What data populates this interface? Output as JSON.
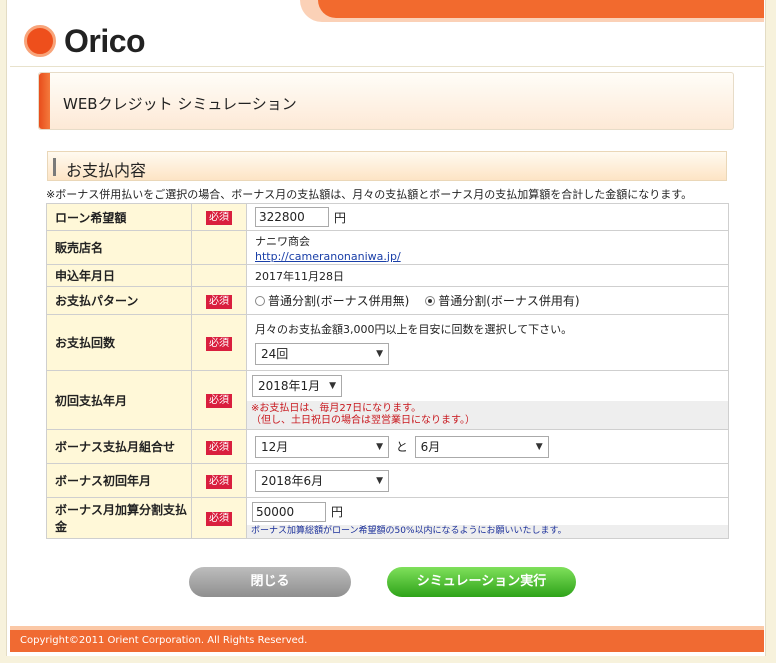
{
  "brand": {
    "logo_text": "Orico"
  },
  "page": {
    "title": "WEBクレジット シミュレーション"
  },
  "section": {
    "title": "お支払内容"
  },
  "note": "※ボーナス併用払いをご選択の場合、ボーナス月の支払額は、月々の支払額とボーナス月の支払加算額を合計した金額になります。",
  "required_label": "必須",
  "form": {
    "loan": {
      "label": "ローン希望額",
      "value": "322800",
      "unit": "円"
    },
    "store": {
      "label": "販売店名",
      "name": "ナニワ商会",
      "url": "http://cameranonaniwa.jp/"
    },
    "apply_date": {
      "label": "申込年月日",
      "value": "2017年11月28日"
    },
    "pattern": {
      "label": "お支払パターン",
      "options": [
        "普通分割(ボーナス併用無)",
        "普通分割(ボーナス併用有)"
      ],
      "selected_index": 1
    },
    "count": {
      "label": "お支払回数",
      "hint": "月々のお支払金額3,000円以上を目安に回数を選択して下さい。",
      "selected": "24回"
    },
    "first_payment": {
      "label": "初回支払年月",
      "selected": "2018年1月",
      "warning_1": "※お支払日は、毎月27日になります。",
      "warning_2": "（但し、土日祝日の場合は翌営業日になります。）"
    },
    "bonus_months": {
      "label": "ボーナス支払月組合せ",
      "month_1": "12月",
      "joiner": "と",
      "month_2": "6月"
    },
    "bonus_first": {
      "label": "ボーナス初回年月",
      "selected": "2018年6月"
    },
    "bonus_amount": {
      "label": "ボーナス月加算分割支払金",
      "value": "50000",
      "unit": "円",
      "info": "ボーナス加算総額がローン希望額の50%以内になるようにお願いいたします。"
    }
  },
  "buttons": {
    "close": "閉じる",
    "run": "シミュレーション実行"
  },
  "footer": {
    "copyright": "Copyright©2011 Orient Corporation. All Rights Reserved."
  },
  "colors": {
    "brand_orange": "#f26a2e",
    "required_red": "#d91f3e",
    "run_green": "#2ea319",
    "label_bg": "#fff8d8"
  }
}
